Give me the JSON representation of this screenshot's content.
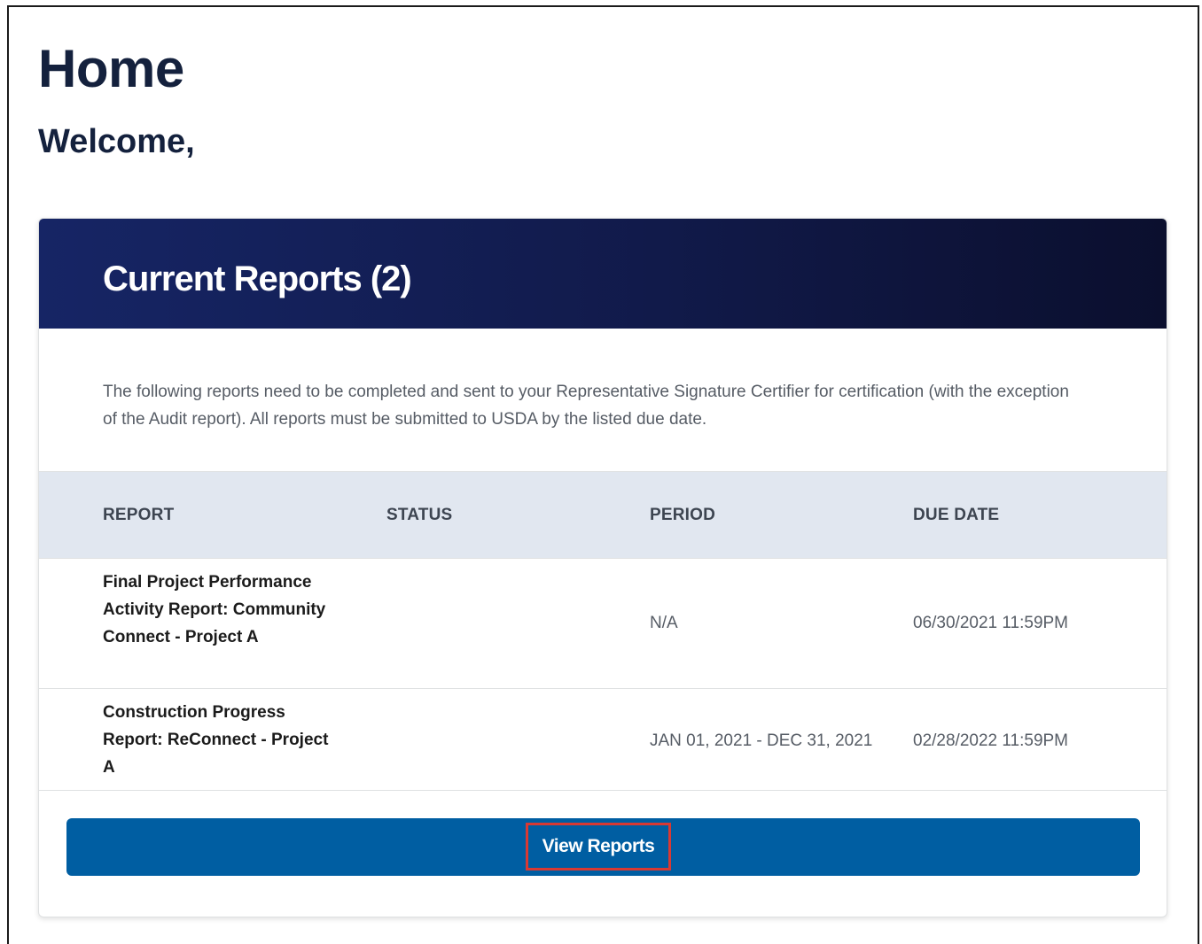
{
  "page": {
    "title": "Home",
    "welcome": "Welcome,"
  },
  "current_reports": {
    "title": "Current Reports (2)",
    "description": "The following reports need to be completed and sent to your Representative Signature Certifier for certification (with the exception of the Audit report).  All reports must be submitted to USDA by the listed due date.",
    "columns": {
      "report": "REPORT",
      "status": "STATUS",
      "period": "PERIOD",
      "due_date": "DUE DATE"
    },
    "rows": [
      {
        "report": "Final Project Performance Activity Report: Community Connect - Project A",
        "status": "",
        "period": "N/A",
        "due_date": "06/30/2021 11:59PM"
      },
      {
        "report": "Construction Progress Report: ReConnect - Project A",
        "status": "",
        "period": "JAN 01, 2021 - DEC 31, 2021",
        "due_date": "02/28/2022 11:59PM"
      }
    ],
    "view_button_label": "View Reports"
  },
  "colors": {
    "header_navy": "#111a4a",
    "button_blue": "#005ea2",
    "highlight_red": "#d83933",
    "table_header_bg": "#e1e7f0"
  }
}
